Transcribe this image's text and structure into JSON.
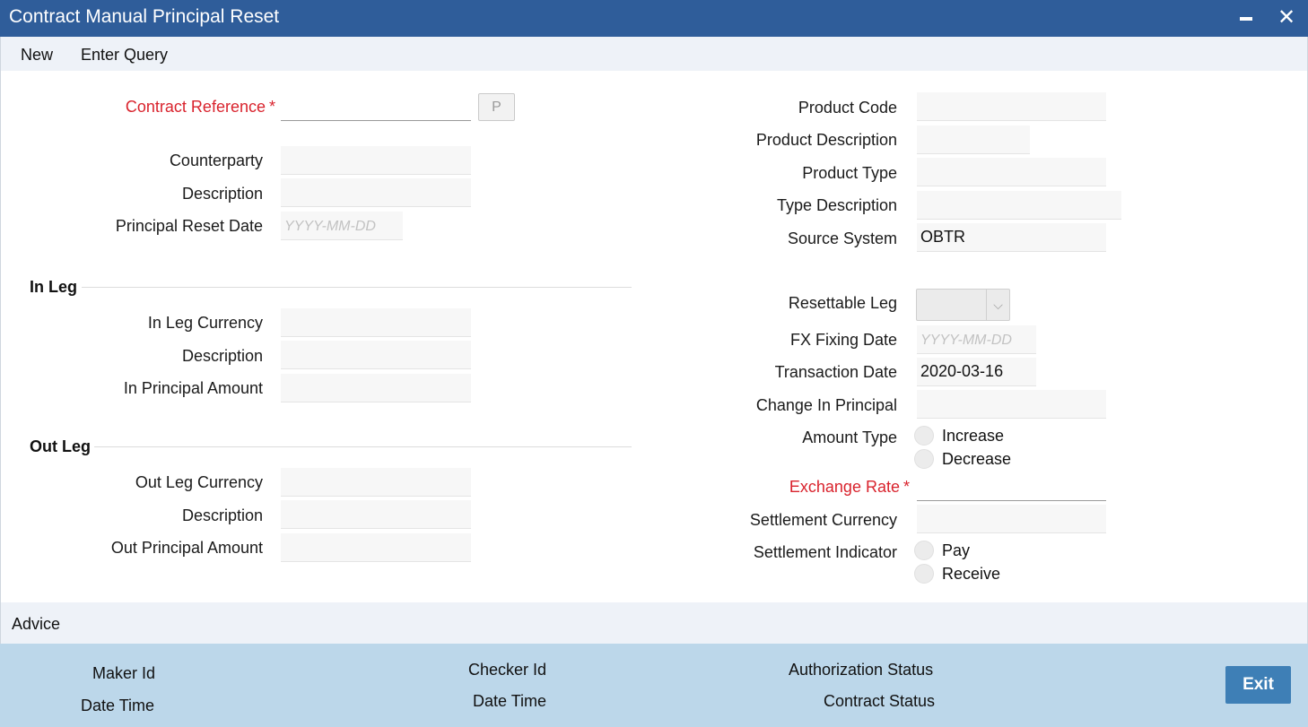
{
  "window": {
    "title": "Contract Manual Principal Reset",
    "minimize_icon": "minimize-icon",
    "close_icon": "close-icon"
  },
  "toolbar": {
    "new_label": "New",
    "enter_query_label": "Enter Query"
  },
  "left": {
    "contract_reference_label": "Contract Reference",
    "contract_reference_value": "",
    "pick_button_label": "P",
    "counterparty_label": "Counterparty",
    "description_label": "Description",
    "principal_reset_date_label": "Principal Reset Date",
    "date_placeholder": "YYYY-MM-DD"
  },
  "in_leg": {
    "section_title": "In Leg",
    "currency_label": "In Leg Currency",
    "description_label": "Description",
    "principal_amount_label": "In Principal Amount"
  },
  "out_leg": {
    "section_title": "Out Leg",
    "currency_label": "Out Leg Currency",
    "description_label": "Description",
    "principal_amount_label": "Out Principal Amount"
  },
  "right": {
    "product_code_label": "Product Code",
    "product_description_label": "Product Description",
    "product_type_label": "Product Type",
    "type_description_label": "Type Description",
    "source_system_label": "Source System",
    "source_system_value": "OBTR",
    "resettable_leg_label": "Resettable Leg",
    "resettable_leg_value": "",
    "fx_fixing_date_label": "FX Fixing Date",
    "date_placeholder": "YYYY-MM-DD",
    "transaction_date_label": "Transaction Date",
    "transaction_date_value": "2020-03-16",
    "change_in_principal_label": "Change In Principal",
    "amount_type_label": "Amount Type",
    "amount_type_options": [
      "Increase",
      "Decrease"
    ],
    "exchange_rate_label": "Exchange Rate",
    "settlement_currency_label": "Settlement Currency",
    "settlement_indicator_label": "Settlement Indicator",
    "settlement_indicator_options": [
      "Pay",
      "Receive"
    ]
  },
  "advice": {
    "label": "Advice"
  },
  "footer": {
    "maker_id_label": "Maker Id",
    "maker_date_time_label": "Date Time",
    "checker_id_label": "Checker Id",
    "checker_date_time_label": "Date Time",
    "authorization_status_label": "Authorization Status",
    "contract_status_label": "Contract Status",
    "exit_label": "Exit"
  },
  "colors": {
    "title_bar": "#2f5d9a",
    "required_label": "#d9232d",
    "footer_bg": "#bcd7ea",
    "exit_button": "#3e7fb6"
  }
}
